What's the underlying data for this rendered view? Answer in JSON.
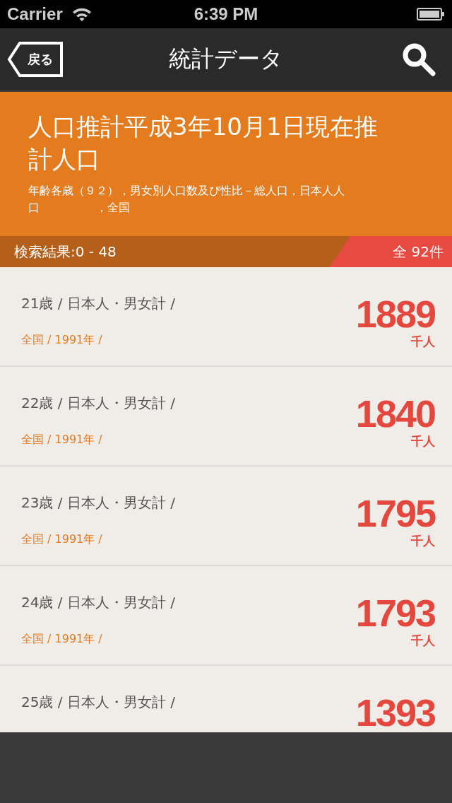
{
  "status_bar": {
    "carrier": "Carrier",
    "time": "6:39 PM"
  },
  "nav": {
    "back": "戻る",
    "title": "統計データ"
  },
  "header": {
    "title": "人口推計平成3年10月1日現在推計人口",
    "subtitle": "年齢各歳（９２），男女別人口数及び性比－総人口，日本人人口　　　　　，全国"
  },
  "results": {
    "range": "検索結果:0 - 48",
    "total": "全 92件"
  },
  "rows": [
    {
      "label": "21歳 / 日本人・男女計 /",
      "location": "全国 / 1991年 /",
      "value": "1889",
      "unit": "千人"
    },
    {
      "label": "22歳 / 日本人・男女計 /",
      "location": "全国 / 1991年 /",
      "value": "1840",
      "unit": "千人"
    },
    {
      "label": "23歳 / 日本人・男女計 /",
      "location": "全国 / 1991年 /",
      "value": "1795",
      "unit": "千人"
    },
    {
      "label": "24歳 / 日本人・男女計 /",
      "location": "全国 / 1991年 /",
      "value": "1793",
      "unit": "千人"
    },
    {
      "label": "25歳 / 日本人・男女計 /",
      "value": "1393"
    }
  ]
}
